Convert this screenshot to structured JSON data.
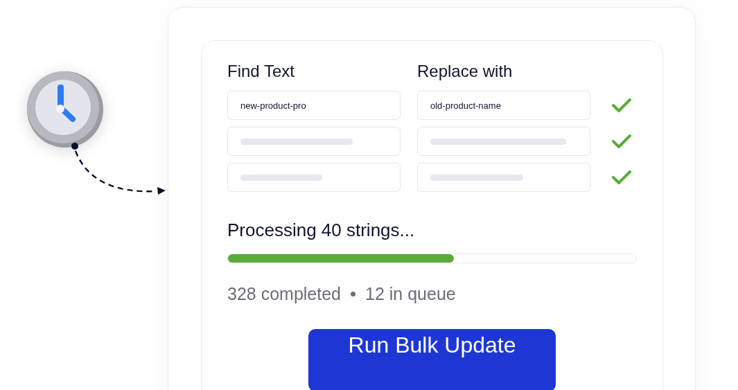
{
  "form": {
    "find_label": "Find Text",
    "replace_label": "Replace with",
    "rows": [
      {
        "kind": "filled",
        "find": "new-product-pro",
        "replace": "old-product-name",
        "checked": true
      },
      {
        "kind": "skeleton",
        "checked": true
      },
      {
        "kind": "skeleton",
        "checked": true
      }
    ]
  },
  "progress": {
    "title": "Processing 40 strings...",
    "level": 0.553,
    "completed": "328 completed",
    "queue": "12 in queue"
  },
  "button": "Run Bulk Update"
}
